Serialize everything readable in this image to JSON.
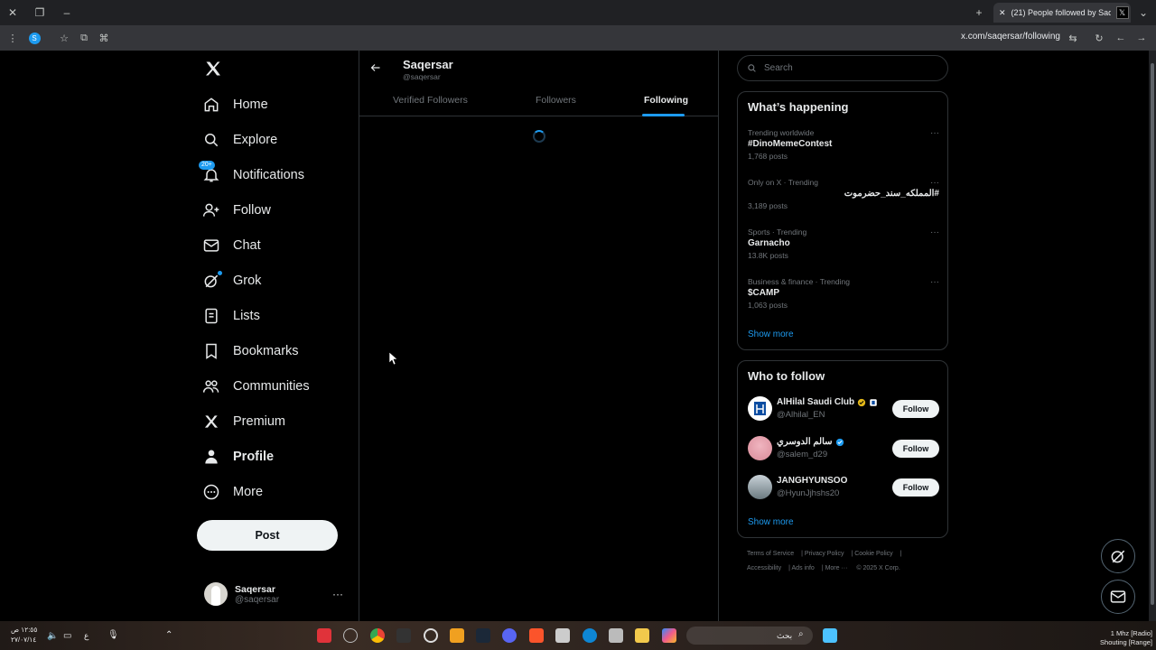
{
  "browser": {
    "tab_title": "(21) People followed by Saqersar",
    "url": "x.com/saqersar/following"
  },
  "nav": {
    "items": [
      {
        "label": "Home",
        "icon": "home-icon"
      },
      {
        "label": "Explore",
        "icon": "search-icon"
      },
      {
        "label": "Notifications",
        "icon": "bell-icon",
        "badge": "20+"
      },
      {
        "label": "Follow",
        "icon": "person-add-icon"
      },
      {
        "label": "Chat",
        "icon": "envelope-icon"
      },
      {
        "label": "Grok",
        "icon": "grok-icon"
      },
      {
        "label": "Lists",
        "icon": "list-icon"
      },
      {
        "label": "Bookmarks",
        "icon": "bookmark-icon"
      },
      {
        "label": "Communities",
        "icon": "people-icon"
      },
      {
        "label": "Premium",
        "icon": "x-logo-icon"
      },
      {
        "label": "Profile",
        "icon": "person-icon"
      },
      {
        "label": "More",
        "icon": "more-circle-icon"
      }
    ],
    "post_label": "Post",
    "account": {
      "name": "Saqersar",
      "handle": "@saqersar"
    }
  },
  "main": {
    "title": "Saqersar",
    "handle": "@saqersar",
    "tabs": [
      "Verified Followers",
      "Followers",
      "Following"
    ],
    "active_tab": "Following"
  },
  "search": {
    "placeholder": "Search"
  },
  "happening": {
    "title": "What’s happening",
    "trends": [
      {
        "meta": "Trending worldwide",
        "name": "#DinoMemeContest",
        "count": "1,768 posts"
      },
      {
        "meta": "Only on X · Trending",
        "name": "#المملكه_سند_حضرموت",
        "count": "3,189 posts"
      },
      {
        "meta": "Sports · Trending",
        "name": "Garnacho",
        "count": "13.8K posts"
      },
      {
        "meta": "Business & finance · Trending",
        "name": "$CAMP",
        "count": "1,063 posts"
      }
    ],
    "show_more": "Show more"
  },
  "who_to_follow": {
    "title": "Who to follow",
    "accounts": [
      {
        "name": "AlHilal Saudi Club",
        "handle": "@Alhilal_EN",
        "follow": "Follow"
      },
      {
        "name": "سالم الدوسري",
        "handle": "@salem_d29",
        "follow": "Follow"
      },
      {
        "name": "JANGHYUNSOO",
        "handle": "@HyunJjhshs20",
        "follow": "Follow"
      }
    ],
    "show_more": "Show more"
  },
  "footer": {
    "links": [
      "Terms of Service",
      "Privacy Policy",
      "Cookie Policy",
      "Accessibility",
      "Ads info",
      "More ···",
      "© 2025 X Corp."
    ]
  },
  "taskbar": {
    "time": "١٢:٥٥ ص",
    "date": "٢٧/٠٧/١٤",
    "lang": "ع",
    "search_text": "بحث",
    "radio_line1": "1 Mhz [Radio]",
    "radio_line2": "Shouting [Range]"
  },
  "colors": {
    "accent": "#1d9bf0",
    "background": "#000000",
    "border": "#2f3336",
    "muted": "#71767b"
  }
}
